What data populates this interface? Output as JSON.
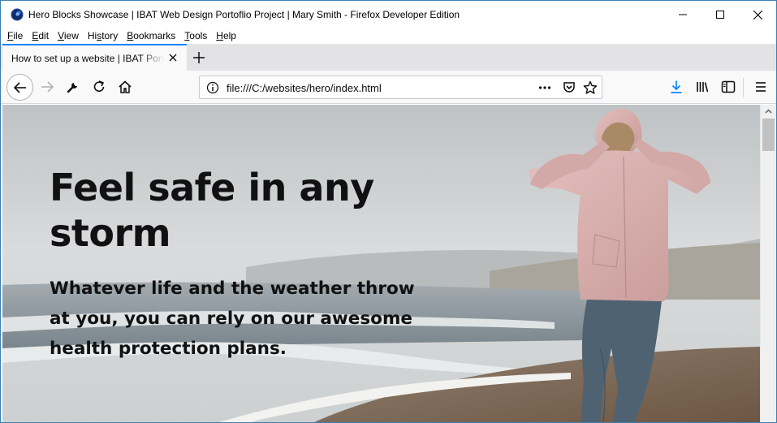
{
  "window": {
    "title": "Hero Blocks Showcase | IBAT Web Design Portoflio Project | Mary Smith - Firefox Developer Edition"
  },
  "menu": {
    "items": [
      {
        "pre": "",
        "ul": "F",
        "post": "ile"
      },
      {
        "pre": "",
        "ul": "E",
        "post": "dit"
      },
      {
        "pre": "",
        "ul": "V",
        "post": "iew"
      },
      {
        "pre": "Hi",
        "ul": "s",
        "post": "tory"
      },
      {
        "pre": "",
        "ul": "B",
        "post": "ookmarks"
      },
      {
        "pre": "",
        "ul": "T",
        "post": "ools"
      },
      {
        "pre": "",
        "ul": "H",
        "post": "elp"
      }
    ]
  },
  "tab": {
    "label": "How to set up a website | IBAT Portfolio"
  },
  "urlbar": {
    "url": "file:///C:/websites/hero/index.html"
  },
  "hero": {
    "title": "Feel safe in any storm",
    "subtitle": "Whatever life and the weather throw at you, you can rely on our awesome health protection plans."
  },
  "colors": {
    "accent": "#0a84ff",
    "download_icon": "#0a84ff",
    "titlebar_border": "#3c7fb1"
  },
  "icons": {
    "app": "firefox-dev-icon",
    "back": "arrow-left-icon",
    "forward": "arrow-right-icon",
    "tools": "wrench-icon",
    "reload": "reload-icon",
    "home": "home-icon",
    "page_info": "info-icon",
    "page_actions": "more-horizontal-icon",
    "pocket": "pocket-icon",
    "bookmark": "star-icon",
    "downloads": "download-icon",
    "library": "library-icon",
    "sidebar": "sidebar-icon",
    "menu": "hamburger-icon"
  }
}
